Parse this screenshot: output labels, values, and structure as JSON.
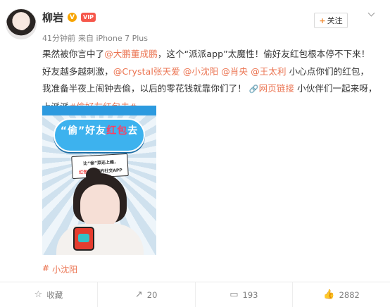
{
  "user": {
    "name": "柳岩",
    "verified_badge": "V",
    "vip_badge": "VIP",
    "follow_plus": "+",
    "follow_label": "关注",
    "time": "41分钟前",
    "source": "来自 iPhone 7 Plus"
  },
  "post": {
    "segments": [
      {
        "t": "果然被你言中了",
        "k": "text"
      },
      {
        "t": "@大鹏董成鹏",
        "k": "mention"
      },
      {
        "t": "，这个“派派app”太魔性！偷好友红包根本停不下来！好友越多越刺激，",
        "k": "text"
      },
      {
        "t": "@Crystal张天爱",
        "k": "mention"
      },
      {
        "t": " ",
        "k": "text"
      },
      {
        "t": "@小沈阳",
        "k": "mention"
      },
      {
        "t": " ",
        "k": "text"
      },
      {
        "t": "@肖央",
        "k": "mention"
      },
      {
        "t": " ",
        "k": "text"
      },
      {
        "t": "@王太利",
        "k": "mention"
      },
      {
        "t": " 小心点你们的红包，我准备半夜上闹钟去偷，以后的零花钱就靠你们了！ ",
        "k": "text"
      },
      {
        "t": "🔗",
        "k": "icon"
      },
      {
        "t": "网页链接",
        "k": "link"
      },
      {
        "t": " 小伙伴们一起来呀，上派派",
        "k": "text"
      },
      {
        "t": "#偷好友红包去#",
        "k": "mention"
      }
    ]
  },
  "image": {
    "title_a": "“偷”好友",
    "title_b": "红包",
    "title_c": "去",
    "panel_line1": "比“偷”菜还上瘾，",
    "panel_line2_red": "红包",
    "panel_line2": "能赚现的社交APP"
  },
  "topic": {
    "hash": "#",
    "label": "小沈阳"
  },
  "actions": [
    {
      "icon": "☆",
      "label": "收藏",
      "name": "favorite"
    },
    {
      "icon": "↗",
      "label": "20",
      "name": "repost"
    },
    {
      "icon": "▭",
      "label": "193",
      "name": "comment"
    },
    {
      "icon": "👍",
      "label": "2882",
      "name": "like"
    }
  ],
  "colors": {
    "accent": "#eb7350",
    "muted": "#808080"
  }
}
